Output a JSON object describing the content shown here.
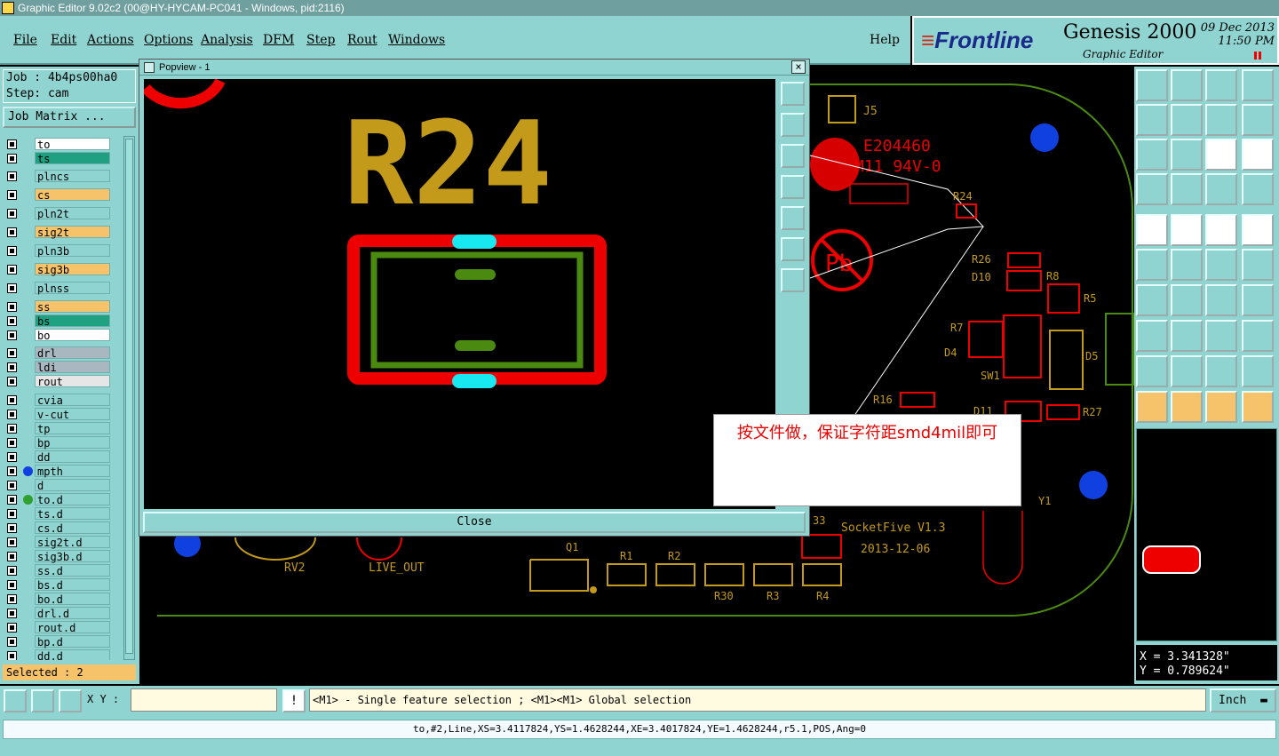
{
  "window_title": "Graphic Editor 9.02c2 (00@HY-HYCAM-PC041 - Windows, pid:2116)",
  "menu": {
    "items": [
      "File",
      "Edit",
      "Actions",
      "Options",
      "Analysis",
      "DFM",
      "Step",
      "Rout",
      "Windows"
    ],
    "help": "Help"
  },
  "brand": {
    "logo": "Frontline",
    "product": "Genesis 2000",
    "subtitle": "Graphic Editor",
    "date": "09 Dec 2013",
    "time": "11:50 PM"
  },
  "job": {
    "job_label": "Job : 4b4ps00ha0",
    "step_label": "Step: cam",
    "matrix_button": "Job Matrix ..."
  },
  "layers": [
    {
      "name": "to",
      "color": "#ffffff",
      "dot": ""
    },
    {
      "name": "ts",
      "color": "#1fa080",
      "dot": ""
    },
    {
      "name": "plncs",
      "color": "#8fd4d0",
      "dot": ""
    },
    {
      "name": "cs",
      "color": "#f6c36b",
      "dot": ""
    },
    {
      "name": "pln2t",
      "color": "#8fd4d0",
      "dot": ""
    },
    {
      "name": "sig2t",
      "color": "#f6c36b",
      "dot": ""
    },
    {
      "name": "pln3b",
      "color": "#8fd4d0",
      "dot": ""
    },
    {
      "name": "sig3b",
      "color": "#f6c36b",
      "dot": ""
    },
    {
      "name": "plnss",
      "color": "#8fd4d0",
      "dot": ""
    },
    {
      "name": "ss",
      "color": "#f6c36b",
      "dot": ""
    },
    {
      "name": "bs",
      "color": "#1fa080",
      "dot": ""
    },
    {
      "name": "bo",
      "color": "#ffffff",
      "dot": ""
    },
    {
      "name": "drl",
      "color": "#a9b8c0",
      "dot": ""
    },
    {
      "name": "ldi",
      "color": "#a9b8c0",
      "dot": ""
    },
    {
      "name": "rout",
      "color": "#e6e6e6",
      "dot": ""
    },
    {
      "name": "cvia",
      "color": "#8fd4d0",
      "dot": ""
    },
    {
      "name": "v-cut",
      "color": "#8fd4d0",
      "dot": ""
    },
    {
      "name": "tp",
      "color": "#8fd4d0",
      "dot": ""
    },
    {
      "name": "bp",
      "color": "#8fd4d0",
      "dot": ""
    },
    {
      "name": "dd",
      "color": "#8fd4d0",
      "dot": ""
    },
    {
      "name": "mpth",
      "color": "#8fd4d0",
      "dot": "#1040e0"
    },
    {
      "name": "d",
      "color": "#8fd4d0",
      "dot": ""
    },
    {
      "name": "to.d",
      "color": "#8fd4d0",
      "dot": "#30a030"
    },
    {
      "name": "ts.d",
      "color": "#8fd4d0",
      "dot": ""
    },
    {
      "name": "cs.d",
      "color": "#8fd4d0",
      "dot": ""
    },
    {
      "name": "sig2t.d",
      "color": "#8fd4d0",
      "dot": ""
    },
    {
      "name": "sig3b.d",
      "color": "#8fd4d0",
      "dot": ""
    },
    {
      "name": "ss.d",
      "color": "#8fd4d0",
      "dot": ""
    },
    {
      "name": "bs.d",
      "color": "#8fd4d0",
      "dot": ""
    },
    {
      "name": "bo.d",
      "color": "#8fd4d0",
      "dot": ""
    },
    {
      "name": "drl.d",
      "color": "#8fd4d0",
      "dot": ""
    },
    {
      "name": "rout.d",
      "color": "#8fd4d0",
      "dot": ""
    },
    {
      "name": "bp.d",
      "color": "#8fd4d0",
      "dot": ""
    },
    {
      "name": "dd.d",
      "color": "#8fd4d0",
      "dot": ""
    }
  ],
  "selected_label": "Selected : 2",
  "popview": {
    "title": "Popview - 1",
    "close_x": "×",
    "close_button": "Close",
    "refdes": "R24"
  },
  "board_labels": {
    "j5": "J5",
    "ul1": "E204460",
    "ul2": "M11 94V-0",
    "pb": "Pb",
    "r24": "R24",
    "r26": "R26",
    "d10": "D10",
    "r8": "R8",
    "r5": "R5",
    "r7": "R7",
    "d4": "D4",
    "sw1": "SW1",
    "d5": "D5",
    "r16": "R16",
    "d11": "D11",
    "r27": "R27",
    "y1": "Y1",
    "c33": "33",
    "socket": "SocketFive V1.3",
    "date": "2013-12-06",
    "q1": "Q1",
    "r1": "R1",
    "r2": "R2",
    "r30": "R30",
    "r3": "R3",
    "r4": "R4",
    "rv2": "RV2",
    "live_out": "LIVE_OUT"
  },
  "note_text": "按文件做，保证字符距smd4mil即可",
  "coords": {
    "x": "X = 3.341328\"",
    "y": "Y = 0.789624\""
  },
  "bottom": {
    "xy_label": "X Y :",
    "xy_value": "",
    "message": "<M1> - Single feature selection ; <M1><M1> Global selection",
    "unit": "Inch"
  },
  "status_line": "to,#2,Line,XS=3.4117824,YS=1.4628244,XE=3.4017824,YE=1.4628244,r5.1,POS,Ang=0",
  "colors": {
    "teal": "#8fd4d0",
    "pad_outline": "#e00000",
    "silk": "#c49a1a",
    "copper": "#4a8a10",
    "cyan": "#18e8f0"
  }
}
